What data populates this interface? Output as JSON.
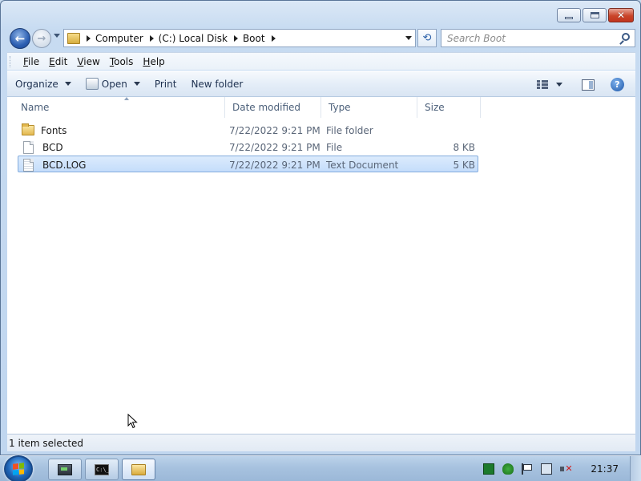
{
  "window": {
    "minimize_label": "minimize",
    "maximize_label": "maximize",
    "close_glyph": "✕"
  },
  "nav": {
    "back_glyph": "←",
    "forward_glyph": "→",
    "breadcrumb": [
      "Computer",
      "(C:) Local Disk",
      "Boot"
    ],
    "refresh_glyph": "⟲",
    "search_placeholder": "Search Boot"
  },
  "menu": [
    {
      "underline": "F",
      "rest": "ile"
    },
    {
      "underline": "E",
      "rest": "dit"
    },
    {
      "underline": "V",
      "rest": "iew"
    },
    {
      "underline": "T",
      "rest": "ools"
    },
    {
      "underline": "H",
      "rest": "elp"
    }
  ],
  "commands": {
    "organize": "Organize",
    "open": "Open",
    "print": "Print",
    "new_folder": "New folder",
    "help_glyph": "?"
  },
  "columns": {
    "name": "Name",
    "date": "Date modified",
    "type": "Type",
    "size": "Size"
  },
  "files": [
    {
      "name": "Fonts",
      "date": "7/22/2022 9:21 PM",
      "type": "File folder",
      "size": "",
      "icon": "folder-icon",
      "selected": false
    },
    {
      "name": "BCD",
      "date": "7/22/2022 9:21 PM",
      "type": "File",
      "size": "8 KB",
      "icon": "file-icon",
      "selected": false
    },
    {
      "name": "BCD.LOG",
      "date": "7/22/2022 9:21 PM",
      "type": "Text Document",
      "size": "5 KB",
      "icon": "text-file-icon",
      "selected": true
    }
  ],
  "status": {
    "text": "1 item selected"
  },
  "taskbar": {
    "cmd_label": "C:\\_",
    "clock": "21:37"
  },
  "colors": {
    "selection": "#c4ddfb",
    "selection_border": "#84acdd",
    "header_text": "#4c607a"
  }
}
